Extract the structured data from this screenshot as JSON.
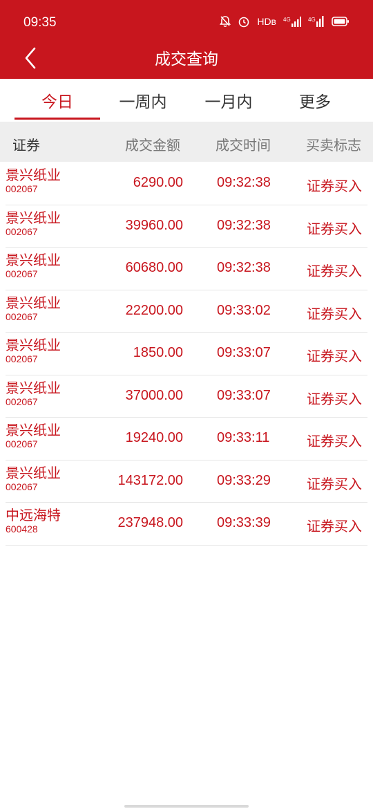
{
  "status_bar": {
    "time": "09:35",
    "hd_label": "HDʙ",
    "net1": "4G",
    "net2": "4G",
    "icons": [
      "bell-off-icon",
      "alarm-icon",
      "signal-icon",
      "battery-icon"
    ]
  },
  "header": {
    "title": "成交查询",
    "back_icon": "chevron-left-icon"
  },
  "tabs": [
    {
      "label": "今日",
      "active": true
    },
    {
      "label": "一周内",
      "active": false
    },
    {
      "label": "一月内",
      "active": false
    },
    {
      "label": "更多",
      "active": false
    }
  ],
  "table": {
    "headers": [
      "证券",
      "成交金额",
      "成交时间",
      "买卖标志"
    ],
    "rows": [
      {
        "name": "景兴纸业",
        "code": "002067",
        "amount": "6290.00",
        "time": "09:32:38",
        "flag": "证券买入"
      },
      {
        "name": "景兴纸业",
        "code": "002067",
        "amount": "39960.00",
        "time": "09:32:38",
        "flag": "证券买入"
      },
      {
        "name": "景兴纸业",
        "code": "002067",
        "amount": "60680.00",
        "time": "09:32:38",
        "flag": "证券买入"
      },
      {
        "name": "景兴纸业",
        "code": "002067",
        "amount": "22200.00",
        "time": "09:33:02",
        "flag": "证券买入"
      },
      {
        "name": "景兴纸业",
        "code": "002067",
        "amount": "1850.00",
        "time": "09:33:07",
        "flag": "证券买入"
      },
      {
        "name": "景兴纸业",
        "code": "002067",
        "amount": "37000.00",
        "time": "09:33:07",
        "flag": "证券买入"
      },
      {
        "name": "景兴纸业",
        "code": "002067",
        "amount": "19240.00",
        "time": "09:33:11",
        "flag": "证券买入"
      },
      {
        "name": "景兴纸业",
        "code": "002067",
        "amount": "143172.00",
        "time": "09:33:29",
        "flag": "证券买入"
      },
      {
        "name": "中远海特",
        "code": "600428",
        "amount": "237948.00",
        "time": "09:33:39",
        "flag": "证券买入"
      }
    ]
  },
  "colors": {
    "brand_red": "#c8161e",
    "header_bg": "#eeeeee"
  }
}
